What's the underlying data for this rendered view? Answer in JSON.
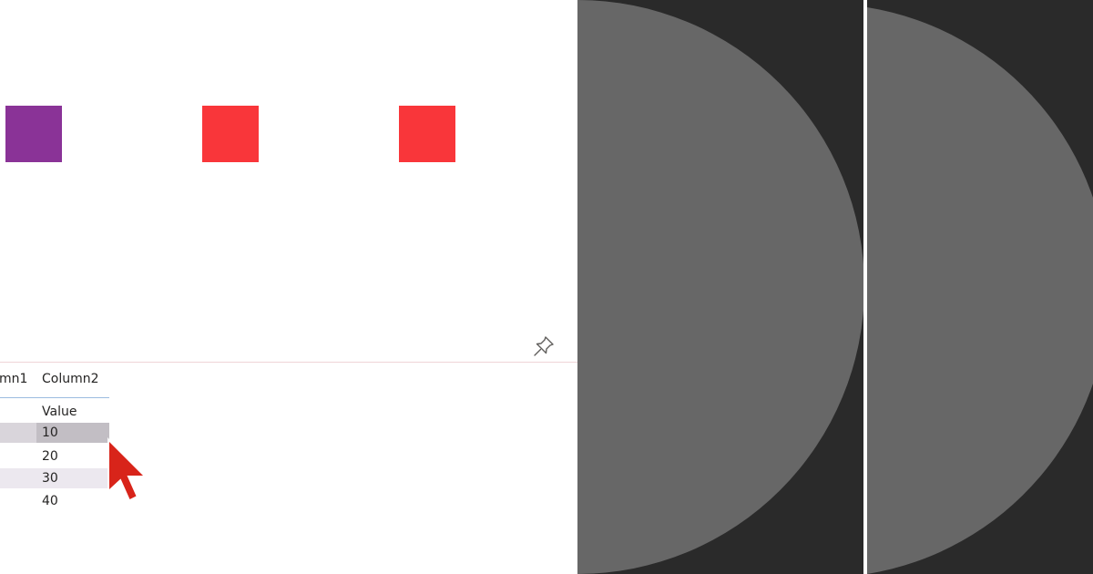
{
  "shapes": {
    "square_colors": [
      "#8a3397",
      "#f9363a",
      "#f9363a"
    ]
  },
  "pin": {
    "icon": "pin-icon"
  },
  "table": {
    "columns": [
      "mn1",
      "Column2"
    ],
    "subheader": "Value",
    "rows": [
      {
        "value": "10",
        "selected": true
      },
      {
        "value": "20",
        "selected": false
      },
      {
        "value": "30",
        "selected": false
      },
      {
        "value": "40",
        "selected": false
      }
    ]
  },
  "cursor": {
    "icon": "mouse-cursor-icon",
    "color": "#d8241a"
  },
  "visuals": {
    "background": "#2a2a2a",
    "shape_color": "#676767",
    "shape": "semicircle"
  }
}
